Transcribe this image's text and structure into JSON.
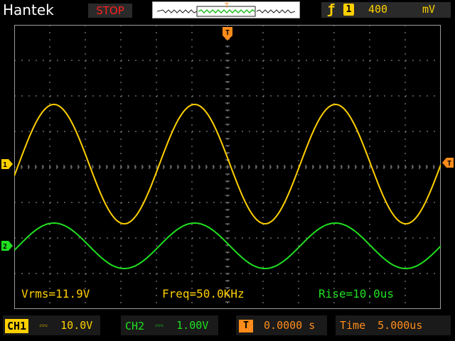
{
  "header": {
    "brand": "Hantek",
    "run_state": "STOP",
    "trigger_marker": "T"
  },
  "trigger": {
    "edge_icon": "rising-edge-icon",
    "source": "1",
    "level": "400",
    "unit": "mV"
  },
  "markers": {
    "trigger_position": "T",
    "ch1_ground": "1",
    "ch2_ground": "2",
    "trigger_level_arrow": "T"
  },
  "measurements": {
    "vrms": "Vrms=11.9V",
    "freq": "Freq=50.0KHz",
    "rise": "Rise=10.0us"
  },
  "status": {
    "ch1_label": "CH1",
    "ch1_coupling": "DC",
    "ch1_scale": "10.0V",
    "ch2_label": "CH2",
    "ch2_coupling": "DC",
    "ch2_scale": "1.00V",
    "offset_icon": "T",
    "trigger_offset": "0.0000 s",
    "time_label": "Time",
    "time_scale": "5.000us"
  },
  "colors": {
    "ch1": "#ffd000",
    "ch2": "#20e020",
    "trigger": "#ff8c1a",
    "stop": "#ff2020",
    "grid": "#9a9a9a"
  }
}
